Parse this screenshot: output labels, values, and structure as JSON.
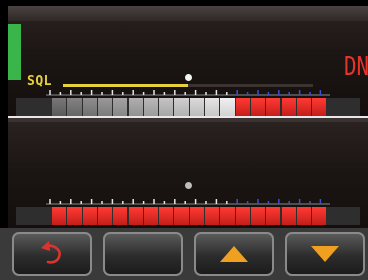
{
  "app": {
    "sql_label": "SQL",
    "direction_label": "DN",
    "squelch_level": 0.5
  },
  "meters": {
    "top": {
      "segments_gray": 12,
      "segments_red": 6
    },
    "bottom": {
      "segments_gray": 0,
      "segments_red": 18
    }
  },
  "colors": {
    "accent_yellow": "#e8d23a",
    "signal_green": "#39b54a",
    "meter_red": "#e8332a",
    "scale_blue": "#3b4fd8"
  },
  "buttons": [
    {
      "icon": "undo-icon"
    },
    {
      "icon": ""
    },
    {
      "icon": "up-arrow-icon"
    },
    {
      "icon": "down-arrow-icon"
    }
  ]
}
